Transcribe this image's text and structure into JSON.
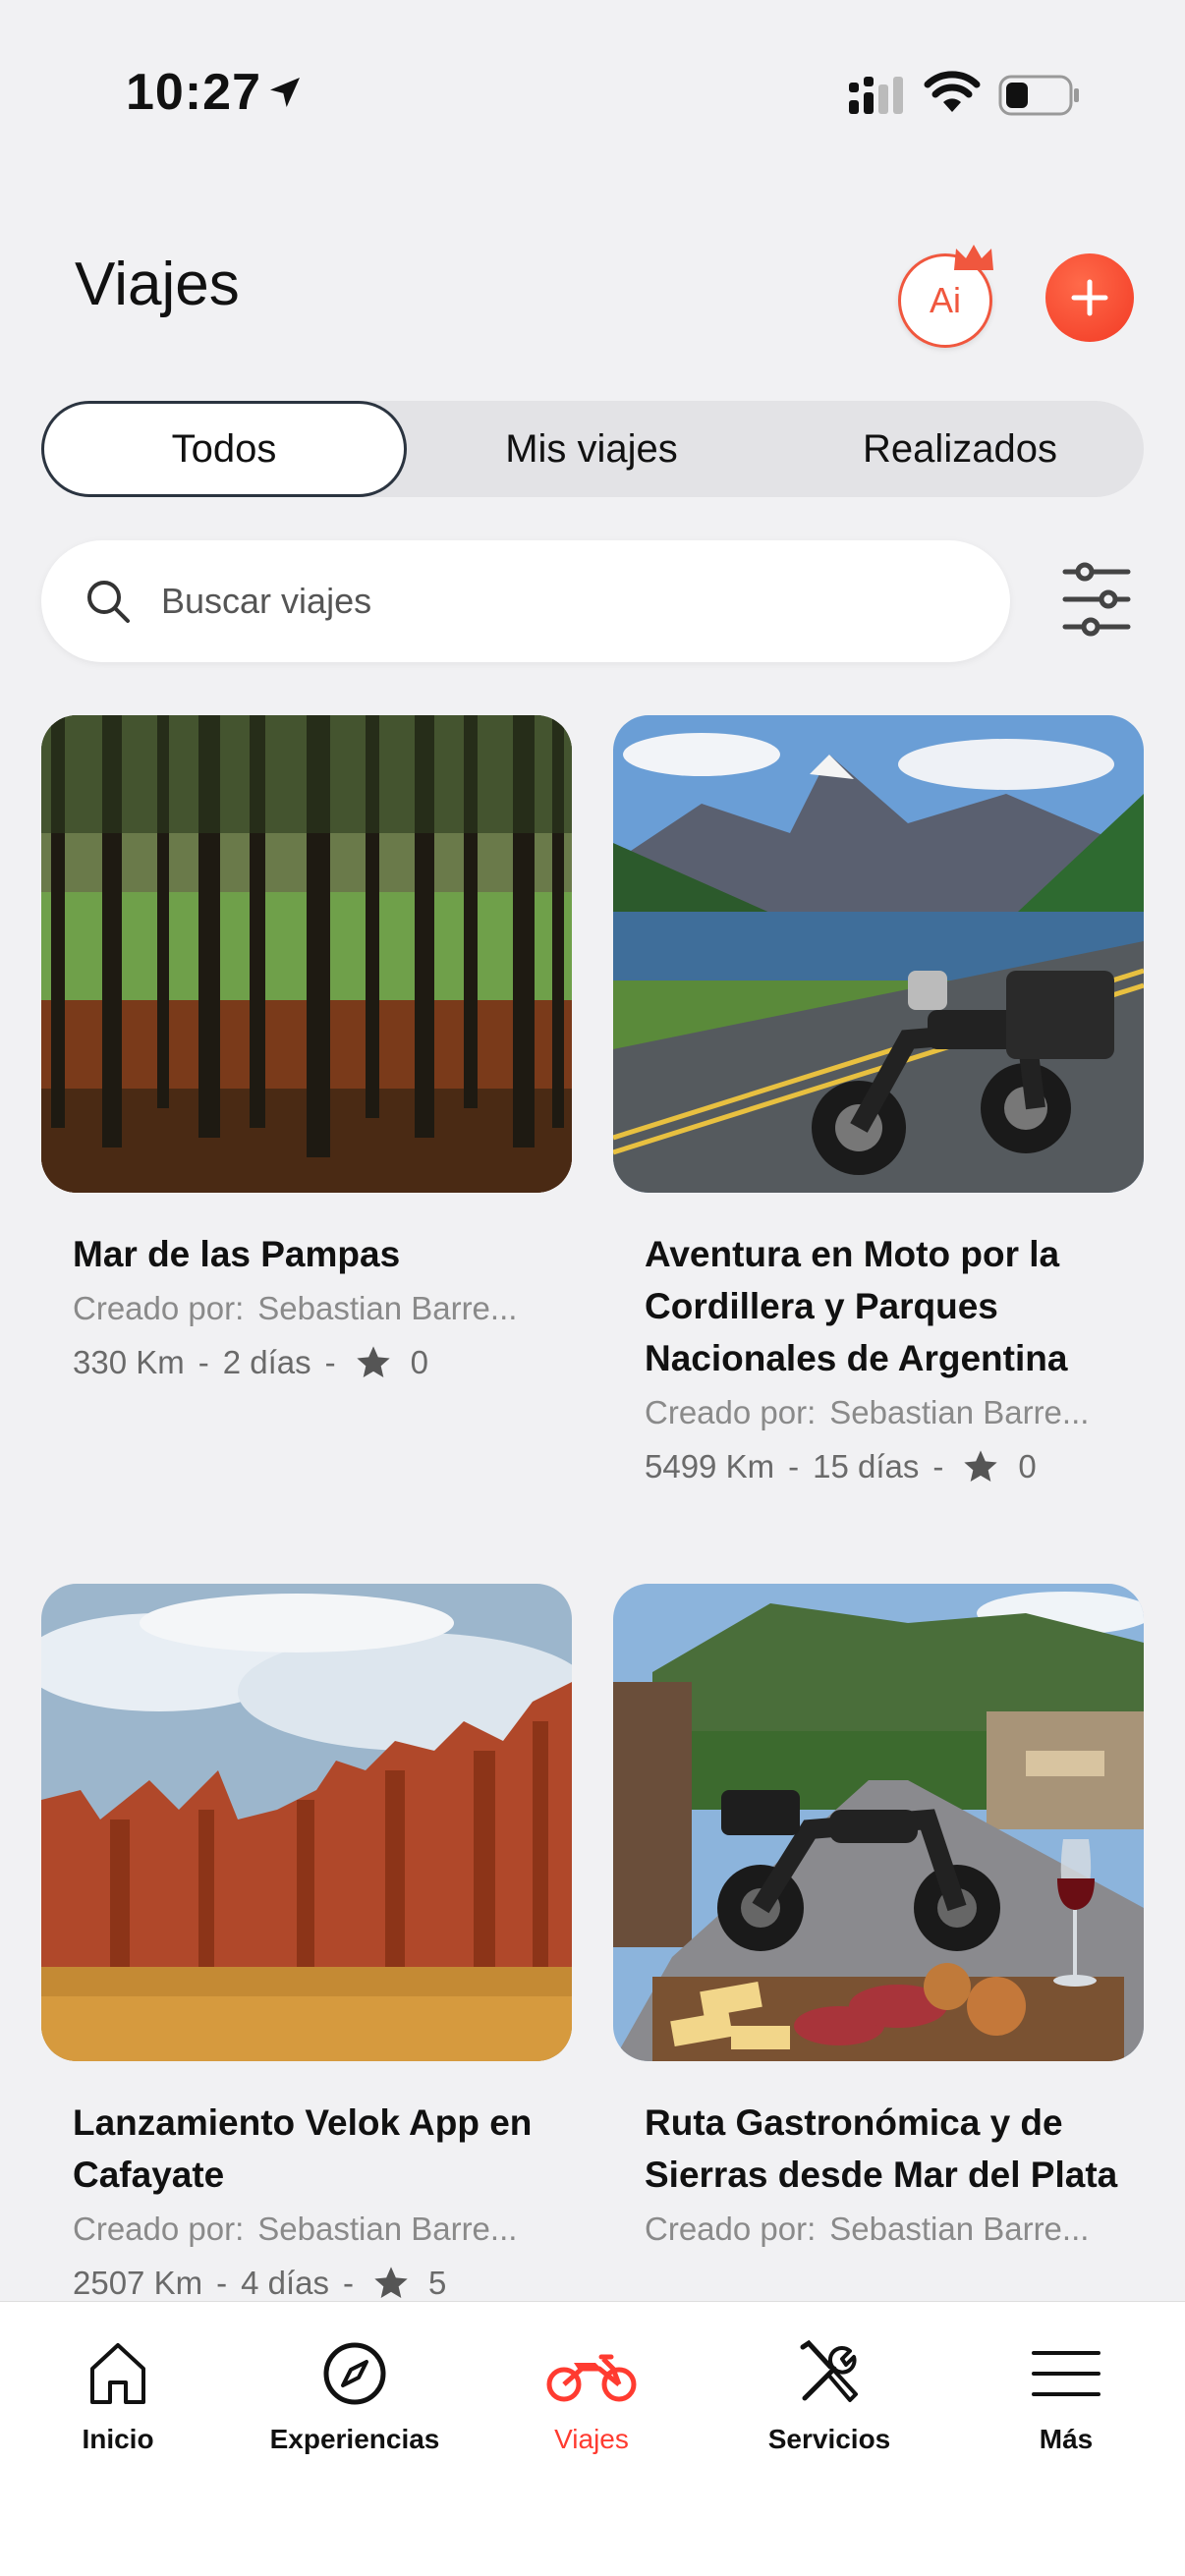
{
  "status": {
    "time": "10:27"
  },
  "header": {
    "title": "Viajes",
    "ai_label": "Ai"
  },
  "tabs": [
    {
      "label": "Todos",
      "active": true
    },
    {
      "label": "Mis viajes",
      "active": false
    },
    {
      "label": "Realizados",
      "active": false
    }
  ],
  "search": {
    "placeholder": "Buscar viajes"
  },
  "trips": [
    {
      "title": "Mar de las Pampas",
      "created_by_label": "Creado por:",
      "author": "Sebastian Barre...",
      "distance": "330 Km",
      "duration": "2 días",
      "rating": "0"
    },
    {
      "title": "Aventura en Moto por la Cordillera y Parques Nacionales de Argentina",
      "created_by_label": "Creado por:",
      "author": "Sebastian Barre...",
      "distance": "5499 Km",
      "duration": "15 días",
      "rating": "0"
    },
    {
      "title": "Lanzamiento Velok App en Cafayate",
      "created_by_label": "Creado por:",
      "author": "Sebastian Barre...",
      "distance": "2507 Km",
      "duration": "4 días",
      "rating": "5"
    },
    {
      "title": "Ruta Gastronómica y de Sierras desde Mar del Plata",
      "created_by_label": "Creado por:",
      "author": "Sebastian Barre..."
    }
  ],
  "nav": {
    "inicio": "Inicio",
    "experiencias": "Experiencias",
    "viajes": "Viajes",
    "servicios": "Servicios",
    "mas": "Más"
  },
  "colors": {
    "accent": "#ff3b30",
    "background": "#f1f1f3"
  },
  "icons": [
    "location-arrow-icon",
    "signal-icon",
    "wifi-icon",
    "battery-icon",
    "search-icon",
    "filter-icon",
    "star-icon",
    "home-icon",
    "compass-icon",
    "motorcycle-icon",
    "tools-icon",
    "menu-icon"
  ]
}
